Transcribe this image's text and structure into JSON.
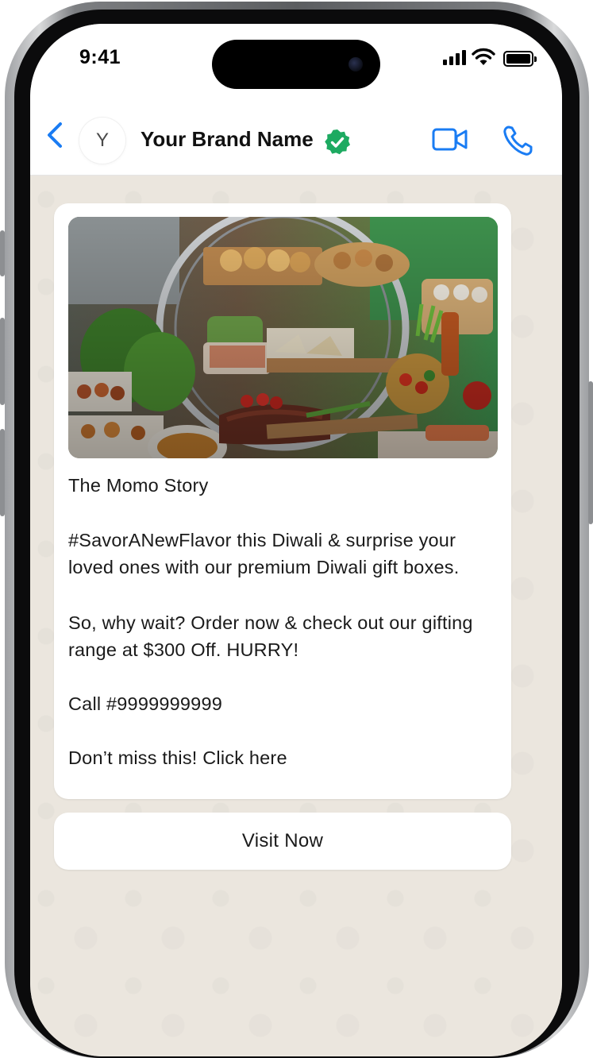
{
  "status_bar": {
    "time": "9:41"
  },
  "chat_header": {
    "avatar_initial": "Y",
    "brand_name": "Your Brand Name",
    "verified": true,
    "accent_color": "#1a7cf3",
    "verified_color": "#1daa61",
    "icons": [
      "chevron-left-icon",
      "video-camera-icon",
      "phone-icon",
      "verified-badge-icon"
    ]
  },
  "message": {
    "image": "food-buffet-photo",
    "title": "The Momo Story",
    "paragraph_1": "#SavorANewFlavor this Diwali & surprise your loved ones with our premium Diwali gift boxes.",
    "paragraph_2": "So, why wait? Order now & check out our gifting range at $300 Off. HURRY!",
    "call_line": "Call #9999999999",
    "closing_line": "Don’t miss this! Click here"
  },
  "cta": {
    "label": "Visit Now"
  },
  "colors": {
    "wallpaper": "#ebe6de",
    "bubble": "#ffffff",
    "text": "#1a1a1a"
  }
}
